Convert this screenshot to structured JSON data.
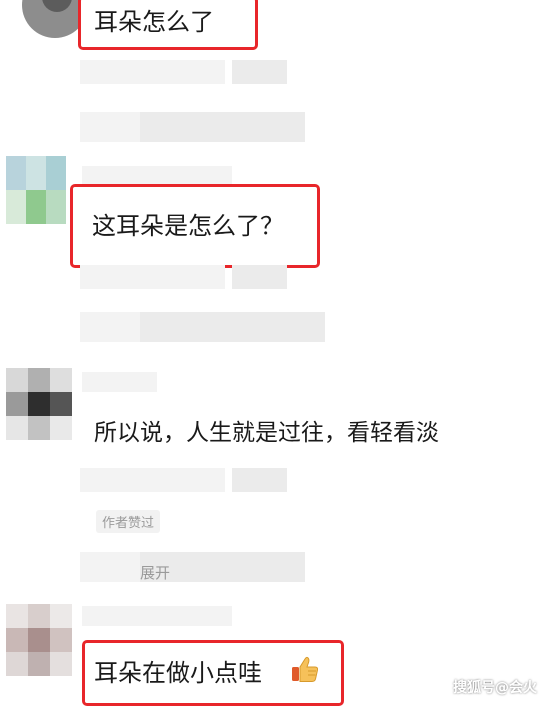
{
  "comments": [
    {
      "text": "耳朵怎么了",
      "highlighted": true
    },
    {
      "text": "这耳朵是怎么了？",
      "highlighted": true
    },
    {
      "text": "所以说，人生就是过往，看轻看淡",
      "highlighted": false
    },
    {
      "text": "耳朵在做小点哇",
      "highlighted": true
    }
  ],
  "author_liked_tag": "作者赞过",
  "partial_text": "展开",
  "watermark": "搜狐号@会火",
  "colors": {
    "highlight_border": "#e8262a",
    "placeholder_blur": "#ebebeb"
  },
  "icons": [
    "thumbs-up-emoji"
  ]
}
